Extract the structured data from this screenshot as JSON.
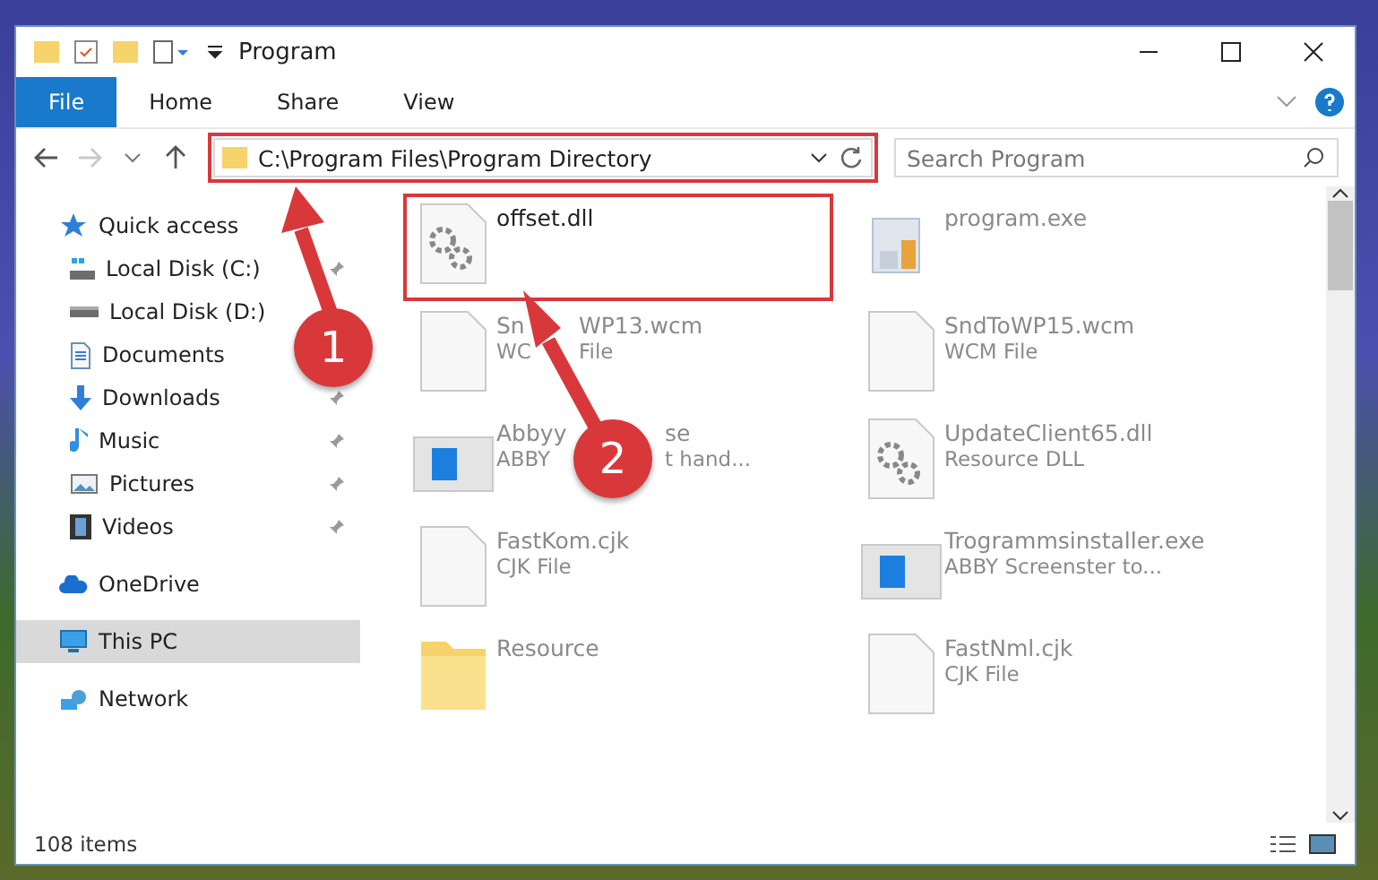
{
  "window": {
    "title": "Program"
  },
  "ribbon_tabs": [
    {
      "label": "File",
      "kind": "menu"
    },
    {
      "label": "Home",
      "kind": "tab"
    },
    {
      "label": "Share",
      "kind": "tab"
    },
    {
      "label": "View",
      "kind": "tab"
    }
  ],
  "address": {
    "text": "C:\\Program Files\\Program Directory",
    "highlighted": true
  },
  "search": {
    "placeholder": "Search Program"
  },
  "sidebar": [
    {
      "label": "Quick access",
      "kind": "star",
      "selected": false,
      "children": [
        {
          "label": "Local Disk (C:)",
          "kind": "drive-c",
          "pinned": true,
          "selected": false
        },
        {
          "label": "Local Disk (D:)",
          "kind": "drive",
          "pinned": false,
          "selected": false
        },
        {
          "label": "Documents",
          "kind": "documents",
          "pinned": false,
          "selected": false
        },
        {
          "label": "Downloads",
          "kind": "downloads",
          "pinned": true,
          "selected": false
        },
        {
          "label": "Music",
          "kind": "music",
          "pinned": true,
          "selected": false
        },
        {
          "label": "Pictures",
          "kind": "pictures",
          "pinned": true,
          "selected": false
        },
        {
          "label": "Videos",
          "kind": "videos",
          "pinned": true,
          "selected": false
        }
      ]
    },
    {
      "label": "OneDrive",
      "kind": "cloud",
      "selected": false
    },
    {
      "label": "This PC",
      "kind": "pc",
      "selected": true
    },
    {
      "label": "Network",
      "kind": "network",
      "selected": false
    }
  ],
  "files": [
    {
      "name": [
        "offset.dll"
      ],
      "kind": "gears",
      "highlighted": true
    },
    {
      "name": [
        "program.exe"
      ],
      "kind": "installer",
      "highlighted": false
    },
    {
      "name": [
        "Sn",
        "WP13.wcm"
      ],
      "type": [
        "WC",
        "File"
      ],
      "kind": "blank",
      "highlighted": false
    },
    {
      "name": [
        "SndToWP15.wcm"
      ],
      "type": [
        "WCM File"
      ],
      "kind": "blank",
      "highlighted": false
    },
    {
      "name": [
        "Abbyy",
        "se"
      ],
      "type": [
        "ABBY",
        "t hand..."
      ],
      "kind": "window",
      "highlighted": false
    },
    {
      "name": [
        "UpdateClient65.dll"
      ],
      "type": [
        "Resource DLL"
      ],
      "kind": "gears",
      "highlighted": false
    },
    {
      "name": [
        "FastKom.cjk"
      ],
      "type": [
        "CJK File"
      ],
      "kind": "blank",
      "highlighted": false
    },
    {
      "name": [
        "Trogrammsinstaller.exe"
      ],
      "type": [
        "ABBY Screenster to..."
      ],
      "kind": "window",
      "highlighted": false
    },
    {
      "name": [
        "Resource"
      ],
      "kind": "folder",
      "highlighted": false
    },
    {
      "name": [
        "FastNml.cjk"
      ],
      "type": [
        "CJK File"
      ],
      "kind": "blank",
      "highlighted": false
    }
  ],
  "status": "108 items",
  "annotations": [
    {
      "number": "1"
    },
    {
      "number": "2"
    }
  ]
}
